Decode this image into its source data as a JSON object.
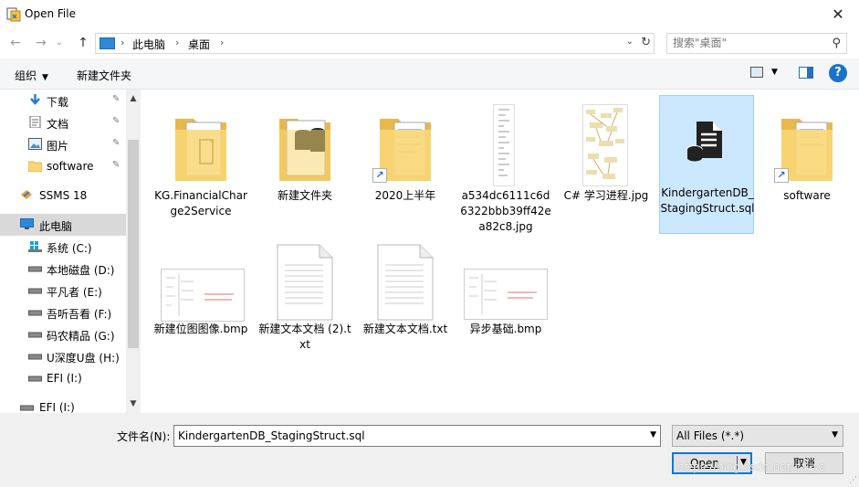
{
  "window": {
    "title": "Open File",
    "close": "✕"
  },
  "nav": {
    "back": "←",
    "forward": "→",
    "recent": "⌄",
    "up": "↑"
  },
  "address": {
    "segments": [
      "此电脑",
      "桌面"
    ],
    "separator": "›",
    "dropdown": "⌄",
    "refresh": "↻"
  },
  "search": {
    "placeholder": "搜索\"桌面\"",
    "icon": "search-icon"
  },
  "toolbar": {
    "organize": "组织",
    "organize_caret": "▼",
    "new_folder": "新建文件夹",
    "view_caret": "▼",
    "help": "?"
  },
  "sidebar": {
    "items": [
      {
        "label": "下载",
        "icon": "download-icon",
        "pinned": true
      },
      {
        "label": "文档",
        "icon": "documents-icon",
        "pinned": true
      },
      {
        "label": "图片",
        "icon": "pictures-icon",
        "pinned": true
      },
      {
        "label": "software",
        "icon": "folder-icon",
        "pinned": true
      },
      {
        "label": "SSMS 18",
        "icon": "ssms-icon",
        "pinned": false
      },
      {
        "label": "此电脑",
        "icon": "this-pc-icon",
        "pinned": false,
        "selected": true
      },
      {
        "label": "系统 (C:)",
        "icon": "drive-icon"
      },
      {
        "label": "本地磁盘 (D:)",
        "icon": "drive-icon"
      },
      {
        "label": "平凡者 (E:)",
        "icon": "drive-icon"
      },
      {
        "label": "吾听吾看 (F:)",
        "icon": "drive-icon"
      },
      {
        "label": "码农精品 (G:)",
        "icon": "drive-icon"
      },
      {
        "label": "U深度U盘 (H:)",
        "icon": "drive-icon"
      },
      {
        "label": "EFI (I:)",
        "icon": "drive-icon"
      },
      {
        "label": "EFI (I:)",
        "icon": "drive-icon"
      }
    ],
    "pin_glyph": "📌",
    "scroll_up": "▲",
    "scroll_down": "▼"
  },
  "files": [
    {
      "name": "KG.FinancialCharge2Service",
      "type": "folder"
    },
    {
      "name": "新建文件夹",
      "type": "folder"
    },
    {
      "name": "2020上半年",
      "type": "folder-shortcut"
    },
    {
      "name": "a534dc6111c6d6322bbb39ff42ea82c8.jpg",
      "type": "image"
    },
    {
      "name": "C# 学习进程.jpg",
      "type": "image"
    },
    {
      "name": "KindergartenDB_StagingStruct.sql",
      "type": "sql",
      "selected": true
    },
    {
      "name": "software",
      "type": "folder-shortcut"
    },
    {
      "name": "新建位图图像.bmp",
      "type": "bmp"
    },
    {
      "name": "新建文本文档 (2).txt",
      "type": "txt"
    },
    {
      "name": "新建文本文档.txt",
      "type": "txt"
    },
    {
      "name": "异步基础.bmp",
      "type": "bmp"
    }
  ],
  "bottom": {
    "filename_label": "文件名(N):",
    "filename_value": "KindergartenDB_StagingStruct.sql",
    "filetype_value": "All Files (*.*)",
    "open_label": "Open",
    "cancel_label": "取消",
    "dropdown": "▼",
    "watermark": "https://blog.csdn.net/ca_va"
  },
  "colors": {
    "selection_bg": "#cce8ff",
    "selection_border": "#99d1ff",
    "accent": "#0078d7",
    "folder": "#f8d775"
  }
}
